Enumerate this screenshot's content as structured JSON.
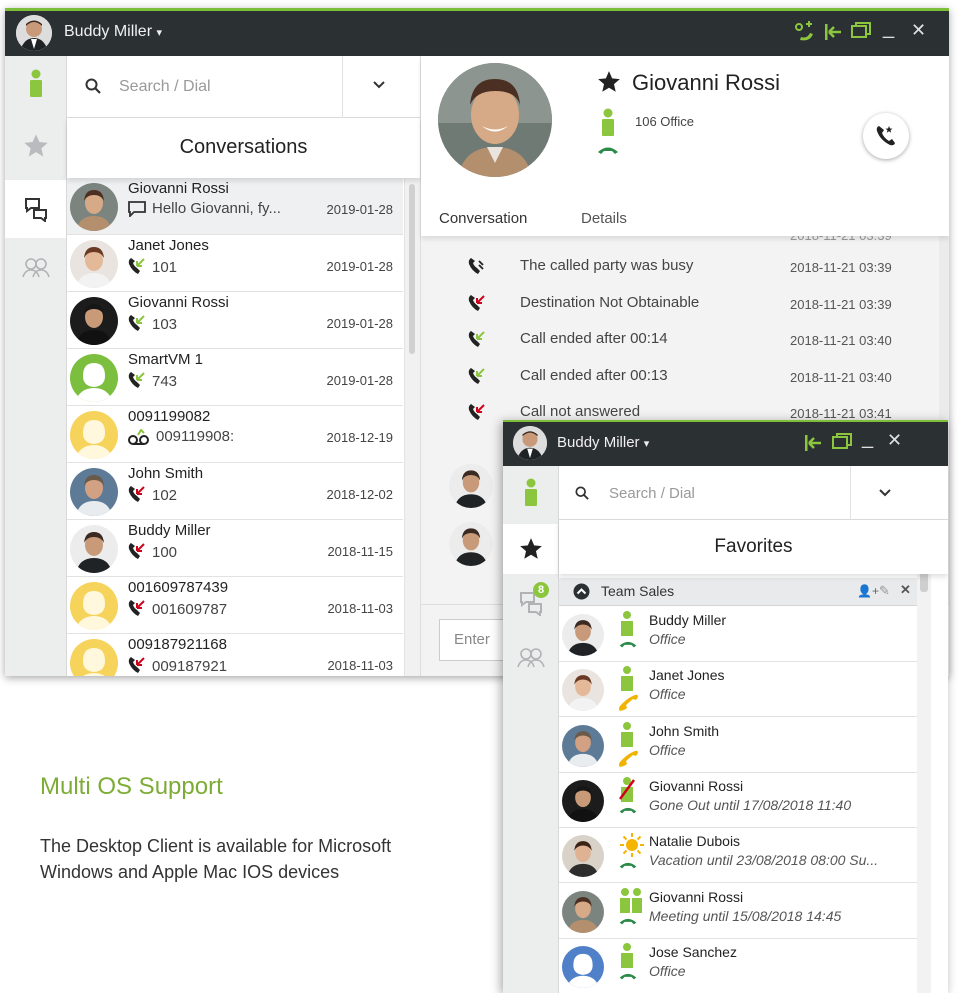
{
  "window1": {
    "user_name": "Buddy Miller",
    "search_placeholder": "Search / Dial",
    "section_title": "Conversations",
    "conversations": [
      {
        "name": "Giovanni Rossi",
        "detail": "Hello Giovanni, fy...",
        "date": "2019-01-28",
        "kind": "chat",
        "avatar": "photo-man-smiling"
      },
      {
        "name": "Janet Jones",
        "detail": "101",
        "date": "2019-01-28",
        "kind": "outgoing",
        "avatar": "photo-woman"
      },
      {
        "name": "Giovanni Rossi",
        "detail": "103",
        "date": "2019-01-28",
        "kind": "outgoing",
        "avatar": "photo-man-dark"
      },
      {
        "name": "SmartVM 1",
        "detail": "743",
        "date": "2019-01-28",
        "kind": "outgoing",
        "avatar": "placeholder-green"
      },
      {
        "name": "0091199082",
        "detail": "009119908:",
        "date": "2018-12-19",
        "kind": "voicemail",
        "avatar": "placeholder-yellow"
      },
      {
        "name": "John Smith",
        "detail": "102",
        "date": "2018-12-02",
        "kind": "missed",
        "avatar": "photo-man-glasses"
      },
      {
        "name": "Buddy Miller",
        "detail": "100",
        "date": "2018-11-15",
        "kind": "missed",
        "avatar": "photo-man-suit"
      },
      {
        "name": "001609787439",
        "detail": "001609787",
        "date": "2018-11-03",
        "kind": "missed",
        "avatar": "placeholder-yellow"
      },
      {
        "name": "009187921168",
        "detail": "009187921",
        "date": "2018-11-03",
        "kind": "missed",
        "avatar": "placeholder-yellow"
      }
    ],
    "contact": {
      "name": "Giovanni Rossi",
      "extension": "106 Office"
    },
    "tabs": [
      "Conversation",
      "Details"
    ],
    "history": [
      {
        "text": "The called party was busy",
        "date": "2018-11-21 03:39",
        "kind": "busy"
      },
      {
        "text": "Destination Not Obtainable",
        "date": "2018-11-21 03:39",
        "kind": "missed"
      },
      {
        "text": "Call ended after 00:14",
        "date": "2018-11-21 03:40",
        "kind": "outgoing"
      },
      {
        "text": "Call ended after 00:13",
        "date": "2018-11-21 03:40",
        "kind": "outgoing"
      },
      {
        "text": "Call not answered",
        "date": "2018-11-21 03:41",
        "kind": "missed"
      }
    ],
    "composer_placeholder": "Enter"
  },
  "window2": {
    "user_name": "Buddy Miller",
    "search_placeholder": "Search / Dial",
    "section_title": "Favorites",
    "badge_count": "8",
    "group_name": "Team Sales",
    "favorites": [
      {
        "name": "Buddy Miller",
        "status": "Office",
        "presence": "available",
        "phone": "idle",
        "avatar": "photo-man-suit"
      },
      {
        "name": "Janet Jones",
        "status": "Office",
        "presence": "available",
        "phone": "ringing",
        "avatar": "photo-woman"
      },
      {
        "name": "John Smith",
        "status": "Office",
        "presence": "available",
        "phone": "ringing",
        "avatar": "photo-man-glasses"
      },
      {
        "name": "Giovanni Rossi",
        "status": "Gone Out until 17/08/2018 11:40",
        "presence": "gone-out",
        "phone": "idle",
        "avatar": "photo-man-dark"
      },
      {
        "name": "Natalie Dubois",
        "status": "Vacation until 23/08/2018 08:00 Su...",
        "presence": "vacation",
        "phone": "idle",
        "avatar": "photo-woman-2"
      },
      {
        "name": "Giovanni Rossi",
        "status": "Meeting until 15/08/2018 14:45",
        "presence": "meeting",
        "phone": "idle",
        "avatar": "photo-man-smiling"
      },
      {
        "name": "Jose Sanchez",
        "status": "Office",
        "presence": "available",
        "phone": "idle",
        "avatar": "placeholder-blue"
      }
    ]
  },
  "marketing": {
    "title": "Multi OS Support",
    "body": "The Desktop Client is available for Microsoft Windows and Apple Mac IOS devices"
  },
  "colors": {
    "brand_green": "#8cc63f",
    "titlebar": "#2b3033",
    "missed_red": "#d0021b",
    "heading_green": "#7dac36",
    "ringing_yellow": "#f0b400"
  }
}
